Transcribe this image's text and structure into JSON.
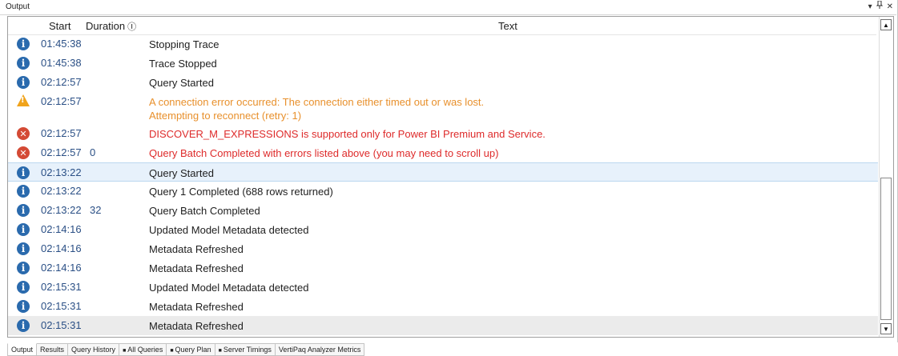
{
  "panel": {
    "title": "Output",
    "buttons": {
      "dropdown": "▾",
      "pin": "ꟷ",
      "close": "✕"
    }
  },
  "columns": {
    "start": "Start",
    "duration": "Duration",
    "duration_icon": "Ⓘ",
    "text": "Text"
  },
  "rows": [
    {
      "icon": "info",
      "start": "01:45:38",
      "duration": "",
      "text": "Stopping Trace",
      "style": "normal"
    },
    {
      "icon": "info",
      "start": "01:45:38",
      "duration": "",
      "text": "Trace Stopped",
      "style": "normal"
    },
    {
      "icon": "info",
      "start": "02:12:57",
      "duration": "",
      "text": "Query Started",
      "style": "normal"
    },
    {
      "icon": "warning",
      "start": "02:12:57",
      "duration": "",
      "text": "A connection error occurred: The connection either timed out or was lost.",
      "text2": "Attempting to reconnect (retry: 1)",
      "style": "warning"
    },
    {
      "icon": "error",
      "start": "02:12:57",
      "duration": "",
      "text": "DISCOVER_M_EXPRESSIONS is supported only for Power BI Premium and Service.",
      "style": "error"
    },
    {
      "icon": "error",
      "start": "02:12:57",
      "duration": "0",
      "text": "Query Batch Completed with errors listed above (you may need to scroll up)",
      "style": "error"
    },
    {
      "icon": "info",
      "start": "02:13:22",
      "duration": "",
      "text": "Query Started",
      "style": "normal",
      "selected": true
    },
    {
      "icon": "info",
      "start": "02:13:22",
      "duration": "",
      "text": "Query 1 Completed (688 rows returned)",
      "style": "normal"
    },
    {
      "icon": "info",
      "start": "02:13:22",
      "duration": "32",
      "text": "Query Batch Completed",
      "style": "normal"
    },
    {
      "icon": "info",
      "start": "02:14:16",
      "duration": "",
      "text": "Updated Model Metadata detected",
      "style": "normal"
    },
    {
      "icon": "info",
      "start": "02:14:16",
      "duration": "",
      "text": "Metadata Refreshed",
      "style": "normal"
    },
    {
      "icon": "info",
      "start": "02:14:16",
      "duration": "",
      "text": "Metadata Refreshed",
      "style": "normal"
    },
    {
      "icon": "info",
      "start": "02:15:31",
      "duration": "",
      "text": "Updated Model Metadata detected",
      "style": "normal"
    },
    {
      "icon": "info",
      "start": "02:15:31",
      "duration": "",
      "text": "Metadata Refreshed",
      "style": "normal"
    },
    {
      "icon": "info",
      "start": "02:15:31",
      "duration": "",
      "text": "Metadata Refreshed",
      "style": "normal",
      "last": true
    }
  ],
  "tabs": [
    {
      "label": "Output",
      "glyph": ""
    },
    {
      "label": "Results",
      "glyph": ""
    },
    {
      "label": "Query History",
      "glyph": ""
    },
    {
      "label": "All Queries",
      "glyph": "■"
    },
    {
      "label": "Query Plan",
      "glyph": "■"
    },
    {
      "label": "Server Timings",
      "glyph": "■"
    },
    {
      "label": "VertiPaq Analyzer Metrics",
      "glyph": ""
    }
  ]
}
